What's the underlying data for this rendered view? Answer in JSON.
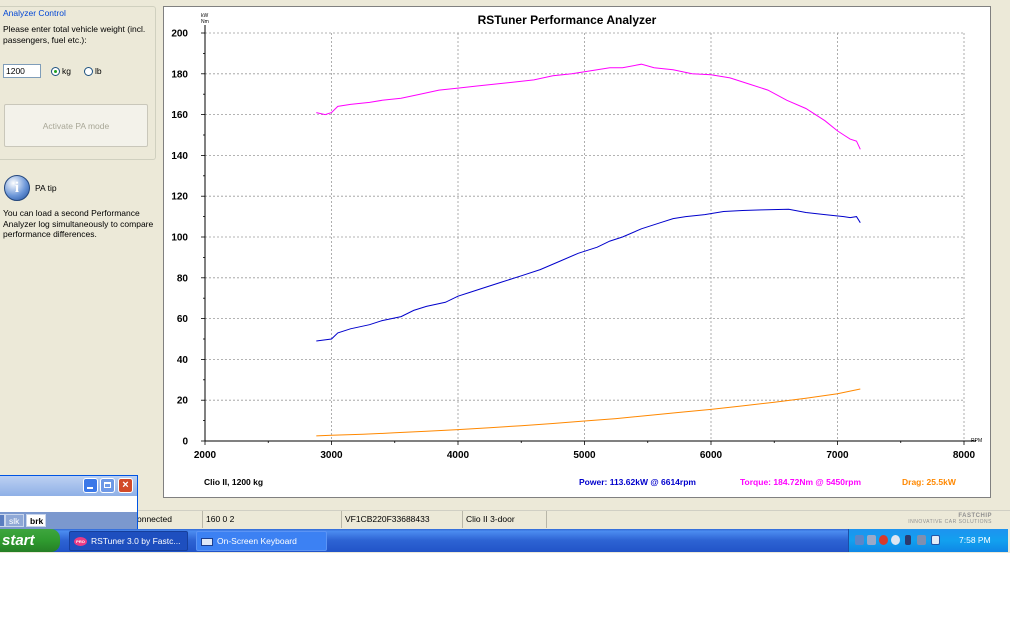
{
  "analyzer": {
    "legend": "Analyzer Control",
    "weight_prompt": "Please enter total vehicle weight (incl. passengers, fuel etc.):",
    "weight_value": "1200",
    "unit_kg": "kg",
    "unit_lb": "lb",
    "selected_unit": "kg",
    "activate_button": "Activate PA mode"
  },
  "tip": {
    "icon": "info-icon",
    "title": "PA tip",
    "text": "You can load a second Performance Analyzer log simultaneously to compare performance differences."
  },
  "status_bar": {
    "connection": "onnected",
    "version": "160 0 2",
    "vin": "VF1CB220F33688433",
    "model": "Clio II 3-door",
    "brand_name": "FASTCHIP",
    "brand_tagline": "INNOVATIVE CAR SOLUTIONS"
  },
  "mini_window": {
    "keys": [
      "",
      "slk",
      "brk"
    ]
  },
  "taskbar": {
    "start_label": "start",
    "tasks": [
      {
        "label": "RSTuner 3.0 by Fastc...",
        "icon": "rstuner-icon",
        "active": true
      },
      {
        "label": "On-Screen Keyboard",
        "icon": "keyboard-icon",
        "active": false
      }
    ],
    "tray_icons": [
      "network-icon",
      "volume-icon",
      "security-icon",
      "antivirus-icon",
      "battery-icon",
      "display-icon",
      "update-icon"
    ],
    "clock": "7:58 PM"
  },
  "chart_data": {
    "type": "line",
    "title": "RSTuner Performance Analyzer",
    "y_unit_label_1": "kW",
    "y_unit_label_2": "Nm",
    "xlabel": "RPM",
    "xlim": [
      2000,
      8000
    ],
    "ylim": [
      0,
      200
    ],
    "x_ticks": [
      2000,
      3000,
      4000,
      5000,
      6000,
      7000,
      8000
    ],
    "y_ticks": [
      0,
      20,
      40,
      60,
      80,
      100,
      120,
      140,
      160,
      180,
      200
    ],
    "grid": true,
    "colors": {
      "power": "#0000cc",
      "torque": "#ff00ff",
      "drag": "#ff8800"
    },
    "footer": {
      "vehicle": "Clio II, 1200 kg",
      "power": "Power: 113.62kW @ 6614rpm",
      "torque": "Torque: 184.72Nm @ 5450rpm",
      "drag": "Drag: 25.5kW"
    },
    "series": [
      {
        "name": "Torque",
        "color": "#ff00ff",
        "points": [
          [
            2880,
            161
          ],
          [
            2950,
            160
          ],
          [
            3000,
            161
          ],
          [
            3050,
            164
          ],
          [
            3150,
            165
          ],
          [
            3300,
            166
          ],
          [
            3400,
            167
          ],
          [
            3550,
            168
          ],
          [
            3700,
            170
          ],
          [
            3850,
            172
          ],
          [
            4000,
            173
          ],
          [
            4150,
            174
          ],
          [
            4300,
            175
          ],
          [
            4450,
            176
          ],
          [
            4600,
            177
          ],
          [
            4750,
            179
          ],
          [
            4900,
            180
          ],
          [
            5000,
            181
          ],
          [
            5100,
            182
          ],
          [
            5200,
            183
          ],
          [
            5300,
            183
          ],
          [
            5450,
            184.7
          ],
          [
            5550,
            183
          ],
          [
            5700,
            182
          ],
          [
            5850,
            180
          ],
          [
            6000,
            179.5
          ],
          [
            6150,
            178
          ],
          [
            6300,
            175
          ],
          [
            6450,
            172
          ],
          [
            6600,
            167
          ],
          [
            6750,
            163
          ],
          [
            6900,
            157
          ],
          [
            7000,
            152
          ],
          [
            7050,
            150
          ],
          [
            7100,
            148
          ],
          [
            7150,
            147
          ],
          [
            7180,
            143
          ]
        ]
      },
      {
        "name": "Power",
        "color": "#0000cc",
        "points": [
          [
            2880,
            49
          ],
          [
            3000,
            50
          ],
          [
            3050,
            53
          ],
          [
            3150,
            55
          ],
          [
            3300,
            57
          ],
          [
            3400,
            59
          ],
          [
            3550,
            61
          ],
          [
            3650,
            64
          ],
          [
            3750,
            66
          ],
          [
            3900,
            68
          ],
          [
            4000,
            71
          ],
          [
            4100,
            73
          ],
          [
            4200,
            75
          ],
          [
            4350,
            78
          ],
          [
            4500,
            81
          ],
          [
            4650,
            84
          ],
          [
            4800,
            88
          ],
          [
            4950,
            92
          ],
          [
            5100,
            95
          ],
          [
            5200,
            98
          ],
          [
            5300,
            100
          ],
          [
            5450,
            104
          ],
          [
            5600,
            107
          ],
          [
            5700,
            109
          ],
          [
            5800,
            110
          ],
          [
            5950,
            111
          ],
          [
            6100,
            112.5
          ],
          [
            6250,
            113
          ],
          [
            6400,
            113.3
          ],
          [
            6614,
            113.6
          ],
          [
            6750,
            112
          ],
          [
            6900,
            111
          ],
          [
            7050,
            110
          ],
          [
            7100,
            109.5
          ],
          [
            7150,
            110
          ],
          [
            7180,
            107
          ]
        ]
      },
      {
        "name": "Drag",
        "color": "#ff8800",
        "points": [
          [
            2880,
            2.5
          ],
          [
            3000,
            2.8
          ],
          [
            3250,
            3.3
          ],
          [
            3500,
            4
          ],
          [
            3750,
            4.8
          ],
          [
            4000,
            5.6
          ],
          [
            4250,
            6.5
          ],
          [
            4500,
            7.5
          ],
          [
            4750,
            8.6
          ],
          [
            5000,
            9.8
          ],
          [
            5250,
            11
          ],
          [
            5500,
            12.5
          ],
          [
            5750,
            14
          ],
          [
            6000,
            15.5
          ],
          [
            6250,
            17.2
          ],
          [
            6500,
            19
          ],
          [
            6750,
            21
          ],
          [
            7000,
            23.2
          ],
          [
            7180,
            25.5
          ]
        ]
      }
    ]
  }
}
